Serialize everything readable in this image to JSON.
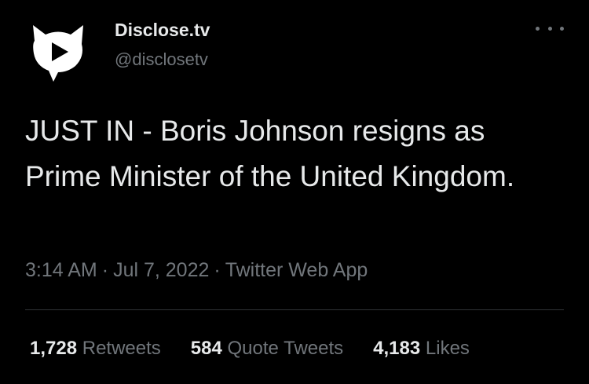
{
  "author": {
    "name": "Disclose.tv",
    "handle": "@disclosetv",
    "avatar_icon": "disclose-tv-logo-icon"
  },
  "more_icon": "more-horizontal-icon",
  "tweet": {
    "text": "JUST IN - Boris Johnson resigns as Prime Minister of the United Kingdom."
  },
  "meta": {
    "time": "3:14 AM",
    "separator": "·",
    "date": "Jul 7, 2022",
    "source": "Twitter Web App"
  },
  "stats": [
    {
      "value": "1,728",
      "label": "Retweets"
    },
    {
      "value": "584",
      "label": "Quote Tweets"
    },
    {
      "value": "4,183",
      "label": "Likes"
    }
  ],
  "colors": {
    "background": "#000000",
    "primary_text": "#e7e9ea",
    "secondary_text": "#71767b",
    "divider": "#2f3336"
  }
}
